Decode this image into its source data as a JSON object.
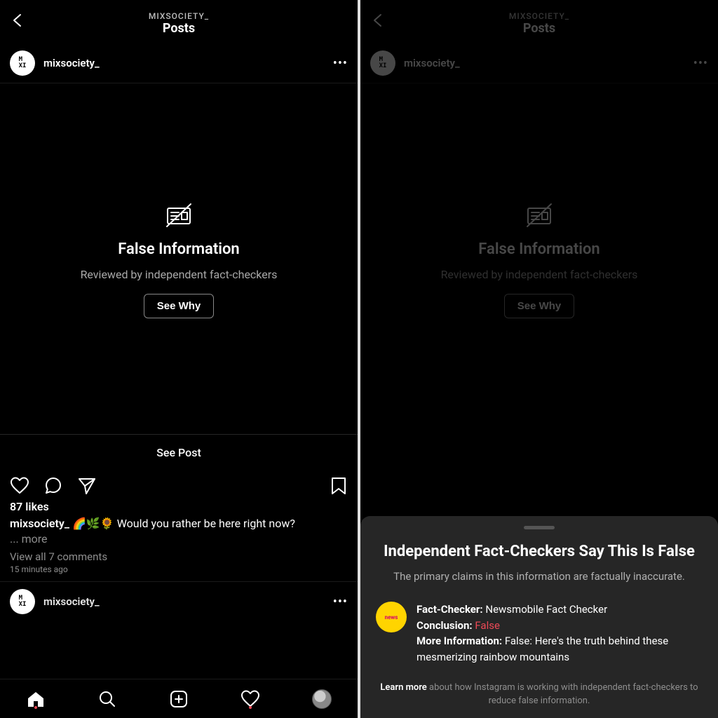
{
  "header": {
    "subtitle": "MIXSOCIETY_",
    "title": "Posts"
  },
  "post": {
    "username": "mixsociety_",
    "false_title": "False Information",
    "false_subtitle": "Reviewed by independent fact-checkers",
    "see_why": "See Why",
    "see_post": "See Post",
    "likes": "87 likes",
    "caption_username": "mixsociety_",
    "caption_text": "🌈🌿🌻  Would you rather be here right now?",
    "caption_more": "... more",
    "view_comments": "View all 7 comments",
    "timestamp": "15 minutes ago"
  },
  "next_post_username": "mixsociety_",
  "sheet": {
    "title": "Independent Fact-Checkers Say This Is False",
    "description": "The primary claims in this information are factually inaccurate.",
    "fc_label": "Fact-Checker:",
    "fc_name": "Newsmobile Fact Checker",
    "conclusion_label": "Conclusion:",
    "conclusion_value": "False",
    "more_label": "More Information:",
    "more_value": "False: Here's the truth behind these mesmerizing rainbow mountains",
    "learn_more_lead": "Learn more",
    "learn_more_rest": " about how Instagram is working with independent fact-checkers to reduce false information."
  }
}
